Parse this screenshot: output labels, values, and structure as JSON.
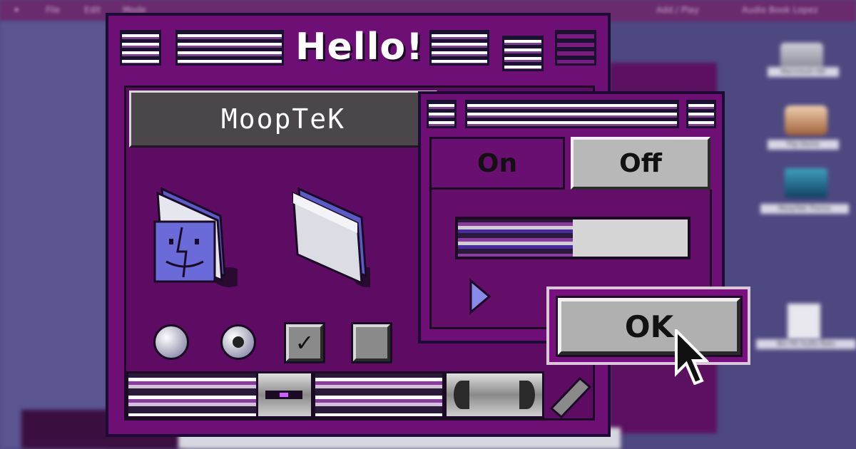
{
  "menubar": {
    "items": [
      "File",
      "Edit",
      "Mode"
    ],
    "right_items": [
      "Add / Play",
      "Audio Book Lopez"
    ]
  },
  "desktop": {
    "icons": [
      {
        "icon": "drive-icon",
        "label": "Macintosh HD"
      },
      {
        "icon": "app-icon",
        "label": "Flip Demo"
      },
      {
        "icon": "document-icon",
        "label": "MoopTeK Theme"
      },
      {
        "icon": "page-icon",
        "label": "Bio Hit Audio Bats"
      }
    ]
  },
  "main_window": {
    "title": "Hello!",
    "label": "MoopTeK",
    "checkbox_mark": "✓"
  },
  "small_window": {
    "tab_on": "On",
    "tab_off": "Off",
    "progress": 0.5
  },
  "ok_button": {
    "label": "OK"
  },
  "colors": {
    "window_bg": "#6d0f74",
    "border": "#1c0b34",
    "accent": "#8a3aa0",
    "desktop": "#4e4880"
  }
}
